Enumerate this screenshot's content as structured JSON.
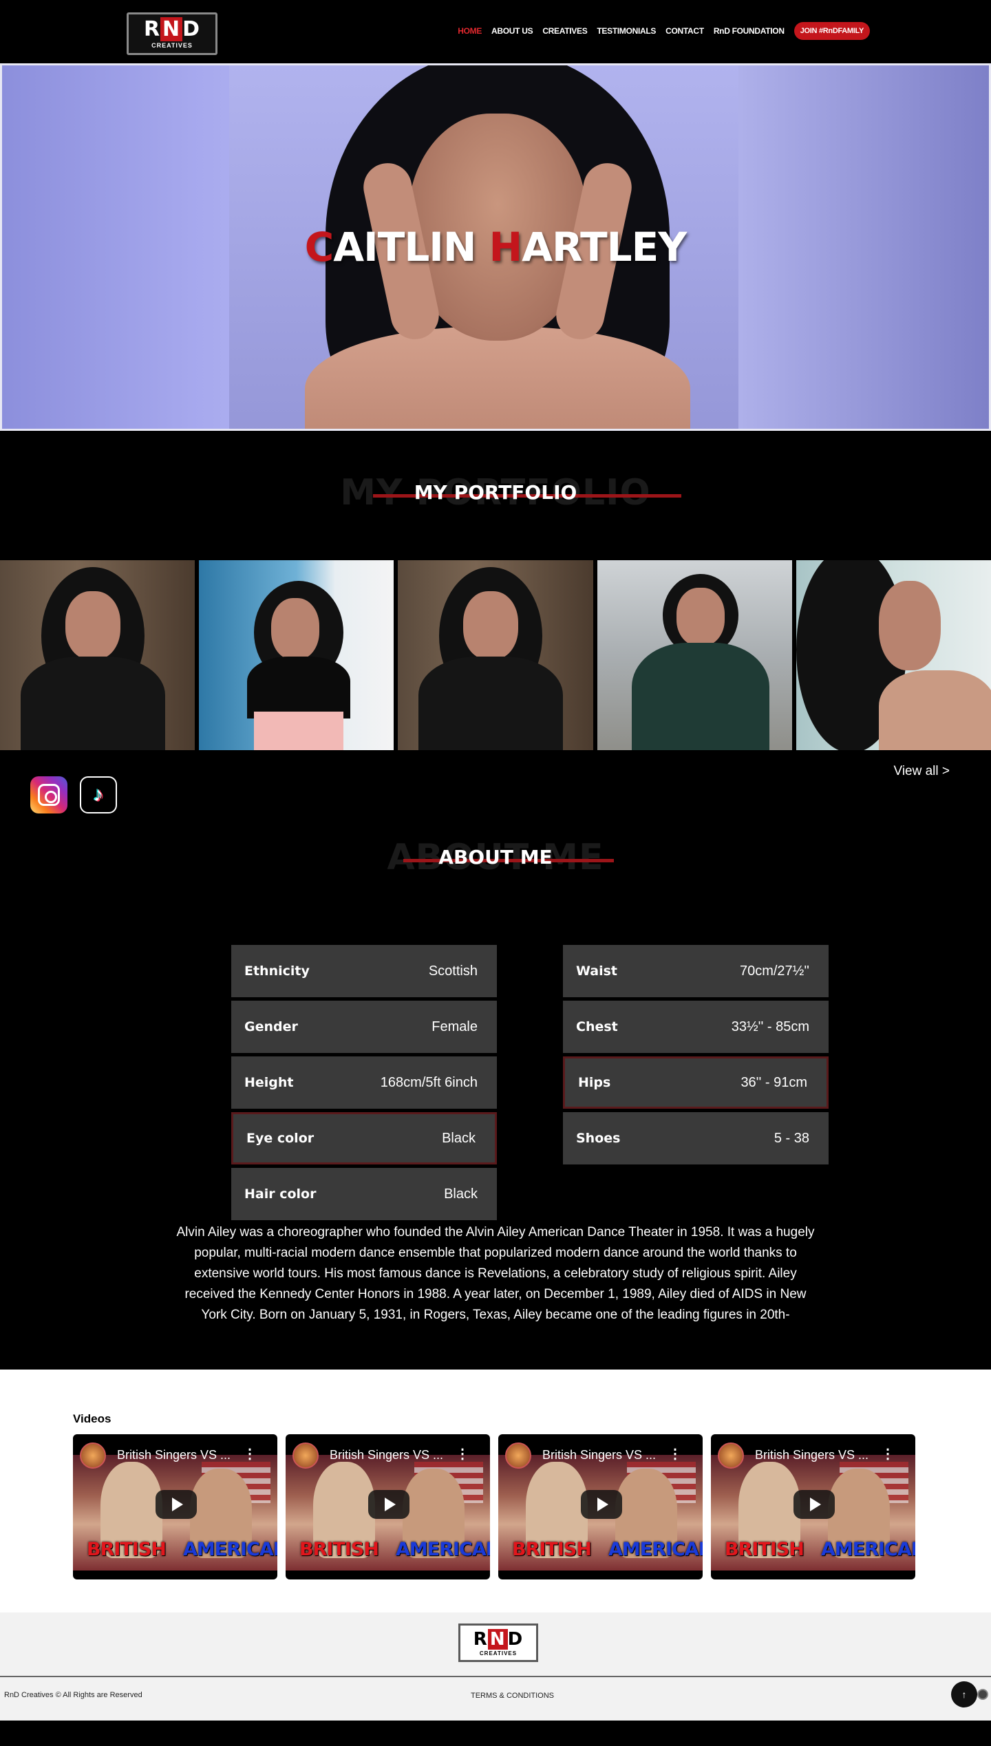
{
  "header": {
    "logo_letters": [
      "R",
      "N",
      "D"
    ],
    "logo_sub": "CREATIVES",
    "nav": [
      {
        "label": "HOME",
        "active": true
      },
      {
        "label": "ABOUT US"
      },
      {
        "label": "CREATIVES"
      },
      {
        "label": "TESTIMONIALS"
      },
      {
        "label": "CONTACT"
      },
      {
        "label": "RnD FOUNDATION"
      }
    ],
    "join_label": "JOIN #RnDFAMILY"
  },
  "hero": {
    "first_initial": "C",
    "first_rest": "AITLIN",
    "last_initial": "H",
    "last_rest": "ARTLEY"
  },
  "portfolio": {
    "title": "MY PORTFOLIO",
    "ghost": "MY PORTFOLIO",
    "photo_count": 5,
    "view_all": "View all >",
    "social": [
      {
        "icon": "instagram-icon"
      },
      {
        "icon": "tiktok-icon"
      }
    ]
  },
  "about": {
    "title": "ABOUT ME",
    "ghost": "ABOUT ME",
    "left_stats": [
      {
        "label": "Ethnicity",
        "value": "Scottish"
      },
      {
        "label": "Gender",
        "value": "Female"
      },
      {
        "label": "Height",
        "value": "168cm/5ft 6inch"
      },
      {
        "label": "Eye color",
        "value": "Black"
      },
      {
        "label": "Hair color",
        "value": "Black"
      }
    ],
    "right_stats": [
      {
        "label": "Waist",
        "value": "70cm/27½''"
      },
      {
        "label": "Chest",
        "value": "33½'' - 85cm"
      },
      {
        "label": "Hips",
        "value": "36'' - 91cm"
      },
      {
        "label": "Shoes",
        "value": "5 - 38"
      }
    ],
    "bio": "Alvin Ailey was a choreographer who founded the Alvin Ailey American Dance Theater in 1958. It was a hugely popular, multi-racial modern dance ensemble that popularized modern dance around the world thanks to extensive world tours. His most famous dance is Revelations, a celebratory study of religious spirit. Ailey received the Kennedy Center Honors in 1988. A year later, on December 1, 1989, Ailey died of AIDS in New York City. Born on January 5, 1931, in Rogers, Texas, Ailey became one of the leading figures in 20th-"
  },
  "videos": {
    "heading": "Videos",
    "items": [
      {
        "title": "British Singers VS ...",
        "caption_left": "BRITISH",
        "caption_right": "AMERICAN"
      },
      {
        "title": "British Singers VS ...",
        "caption_left": "BRITISH",
        "caption_right": "AMERICAN"
      },
      {
        "title": "British Singers VS ...",
        "caption_left": "BRITISH",
        "caption_right": "AMERICAN"
      },
      {
        "title": "British Singers VS ...",
        "caption_left": "BRITISH",
        "caption_right": "AMERICAN"
      }
    ]
  },
  "footer": {
    "copyright": "RnD Creatives © All Rights are Reserved",
    "terms": "TERMS & CONDITIONS",
    "top_glyph": "↑"
  },
  "colors": {
    "accent": "#c4161c",
    "panel": "#3a3a3a"
  }
}
